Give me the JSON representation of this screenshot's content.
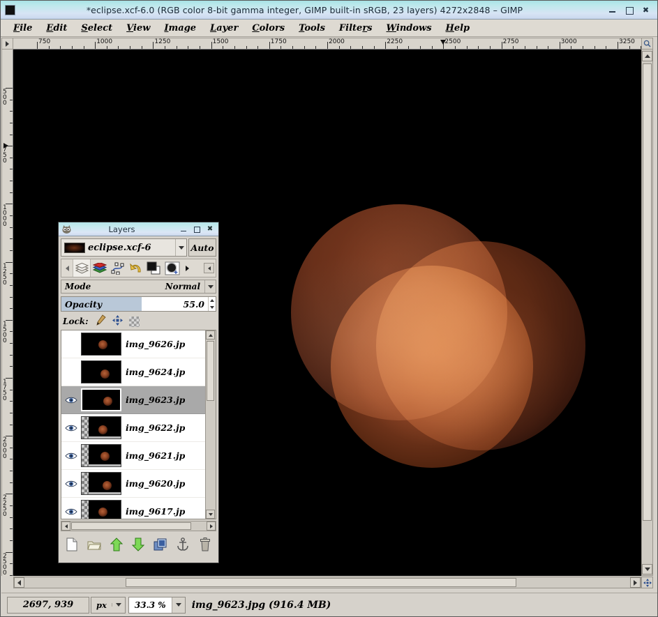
{
  "window": {
    "title": "*eclipse.xcf-6.0 (RGB color 8-bit gamma integer, GIMP built-in sRGB, 23 layers) 4272x2848 – GIMP",
    "minimize_label": "",
    "maximize_label": "",
    "close_label": "✖"
  },
  "menubar": {
    "items": [
      {
        "label": "File",
        "accel": "F"
      },
      {
        "label": "Edit",
        "accel": "E"
      },
      {
        "label": "Select",
        "accel": "S"
      },
      {
        "label": "View",
        "accel": "V"
      },
      {
        "label": "Image",
        "accel": "I"
      },
      {
        "label": "Layer",
        "accel": "L"
      },
      {
        "label": "Colors",
        "accel": "C"
      },
      {
        "label": "Tools",
        "accel": "T"
      },
      {
        "label": "Filters",
        "accel": "r"
      },
      {
        "label": "Windows",
        "accel": "W"
      },
      {
        "label": "Help",
        "accel": "H"
      }
    ]
  },
  "rulers": {
    "unit": "px",
    "horizontal_labels": [
      "750",
      "1000",
      "1250",
      "1500",
      "1750",
      "2000",
      "2250",
      "2500",
      "2750",
      "3000",
      "3250"
    ],
    "horizontal_cursor": "2500",
    "vertical_labels": [
      "500",
      "750",
      "1000",
      "1250",
      "1500",
      "1750",
      "2000",
      "2250",
      "2500"
    ],
    "vertical_cursor": "750"
  },
  "statusbar": {
    "position": "2697, 939",
    "unit": "px",
    "zoom": "33.3 %",
    "message": "img_9623.jpg (916.4 MB)"
  },
  "layers_dialog": {
    "title": "Layers",
    "image_name": "eclipse.xcf-6",
    "auto_button": "Auto",
    "tabs": [
      {
        "name": "layers-tab",
        "icon": "layers-stack-icon",
        "active": true
      },
      {
        "name": "channels-tab",
        "icon": "channels-icon",
        "active": false
      },
      {
        "name": "paths-tab",
        "icon": "paths-icon",
        "active": false
      },
      {
        "name": "undo-history-tab",
        "icon": "undo-arrow-icon",
        "active": false
      },
      {
        "name": "colors-tab",
        "icon": "fg-bg-color-icon",
        "active": false
      },
      {
        "name": "brushes-tab",
        "icon": "brush-blob-icon",
        "active": false
      }
    ],
    "mode_label": "Mode",
    "mode_value": "Normal",
    "opacity_label": "Opacity",
    "opacity_value": "55.0",
    "opacity_percent": 55,
    "lock_label": "Lock:",
    "lock_items": [
      "lock-pixels-icon",
      "lock-position-icon",
      "lock-alpha-icon"
    ],
    "layers": [
      {
        "name": "img_9626.jp",
        "visible": false,
        "selected": false,
        "has_alpha": false
      },
      {
        "name": "img_9624.jp",
        "visible": false,
        "selected": false,
        "has_alpha": false
      },
      {
        "name": "img_9623.jp",
        "visible": true,
        "selected": true,
        "has_alpha": false
      },
      {
        "name": "img_9622.jp",
        "visible": true,
        "selected": false,
        "has_alpha": true
      },
      {
        "name": "img_9621.jp",
        "visible": true,
        "selected": false,
        "has_alpha": true
      },
      {
        "name": "img_9620.jp",
        "visible": true,
        "selected": false,
        "has_alpha": true
      },
      {
        "name": "img_9617.jp",
        "visible": true,
        "selected": false,
        "has_alpha": true
      }
    ],
    "toolbar_buttons": [
      {
        "name": "new-layer-button",
        "icon": "new-page-icon"
      },
      {
        "name": "new-layer-group-button",
        "icon": "folder-icon"
      },
      {
        "name": "raise-layer-button",
        "icon": "up-arrow-icon"
      },
      {
        "name": "lower-layer-button",
        "icon": "down-arrow-icon"
      },
      {
        "name": "duplicate-layer-button",
        "icon": "copy-icon"
      },
      {
        "name": "anchor-layer-button",
        "icon": "anchor-icon"
      },
      {
        "name": "delete-layer-button",
        "icon": "trash-icon"
      }
    ]
  },
  "colors": {
    "titlebar_gradient_start": "#a9e3e6",
    "titlebar_gradient_end": "#c9d8ee",
    "chrome": "#d6d2cb",
    "canvas_background": "#000000",
    "selection_highlight": "#a9a9a9",
    "opacity_fill": "#b9c8d8",
    "moon_primary": "#93492a",
    "moon_secondary": "#6d3118"
  }
}
